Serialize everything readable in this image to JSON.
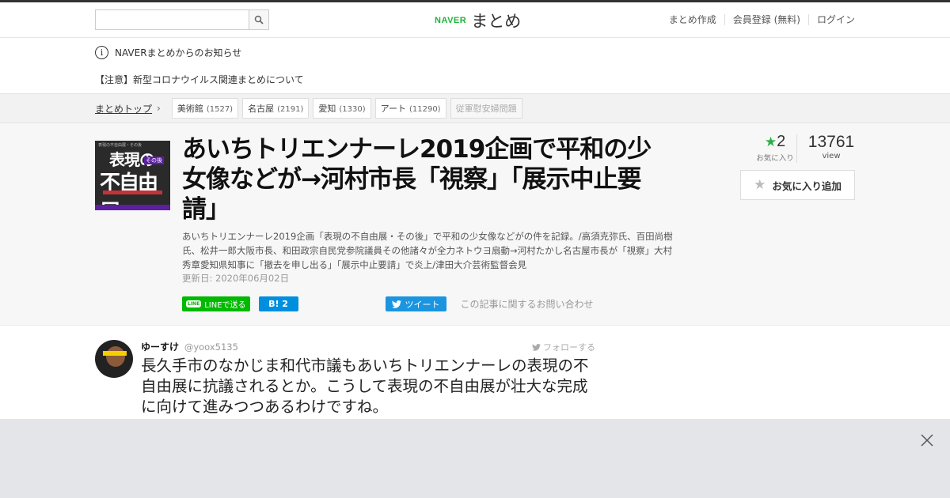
{
  "header": {
    "search": {
      "value": "",
      "placeholder": ""
    },
    "logo_naver": "NAVER",
    "logo_matome": "まとめ",
    "nav": [
      "まとめ作成",
      "会員登録 (無料)",
      "ログイン"
    ]
  },
  "notice": {
    "heading": "NAVERまとめからのお知らせ",
    "link": "【注意】新型コロナウイルス関連まとめについて"
  },
  "breadcrumb": {
    "top": "まとめトップ",
    "tags": [
      {
        "label": "美術館",
        "count": "(1527)"
      },
      {
        "label": "名古屋",
        "count": "(2191)"
      },
      {
        "label": "愛知",
        "count": "(1330)"
      },
      {
        "label": "アート",
        "count": "(11290)"
      },
      {
        "label": "従軍慰安婦問題",
        "count": ""
      }
    ]
  },
  "article": {
    "thumb_small": "表現の不自由展・その後",
    "thumb_line1": "表現の",
    "thumb_line2": "不自由展",
    "thumb_badge": "その後",
    "title": "あいちトリエンナーレ2019企画で平和の少女像などが→河村市長「視察」「展示中止要請」",
    "description": "あいちトリエンナーレ2019企画「表現の不自由展・その後」で平和の少女像などがの件を記録。/高須克弥氏、百田尚樹氏、松井一郎大阪市長、和田政宗自民党参院議員その他諸々が全力ネトウヨ扇動→河村たかし名古屋市長が「視察」大村秀章愛知県知事に「撤去を申し出る」「展示中止要請」で炎上/津田大介芸術監督会見",
    "updated": "更新日: 2020年06月02日",
    "share": {
      "line": "LINEで送る",
      "line_icon_text": "LINE",
      "hatena": "B! 2",
      "tweet": "ツイート",
      "contact": "この記事に関するお問い合わせ"
    },
    "favorites": {
      "count": "2",
      "label": "お気に入り"
    },
    "views": {
      "count": "13761",
      "label": "view"
    },
    "fav_button": "お気に入り追加"
  },
  "tweet": {
    "name": "ゆーすけ",
    "handle": "@yoox5135",
    "follow": "フォローする",
    "text": "長久手市のなかじま和代市議もあいちトリエンナーレの表現の不自由展に抗議されるとか。こうして表現の不自由展が壮大な完成に向けて進みつつあるわけですね。"
  },
  "colors": {
    "accent_green": "#1fb33a",
    "line_green": "#00b900",
    "hatena_blue": "#008fde",
    "twitter_blue": "#1b95e0"
  }
}
